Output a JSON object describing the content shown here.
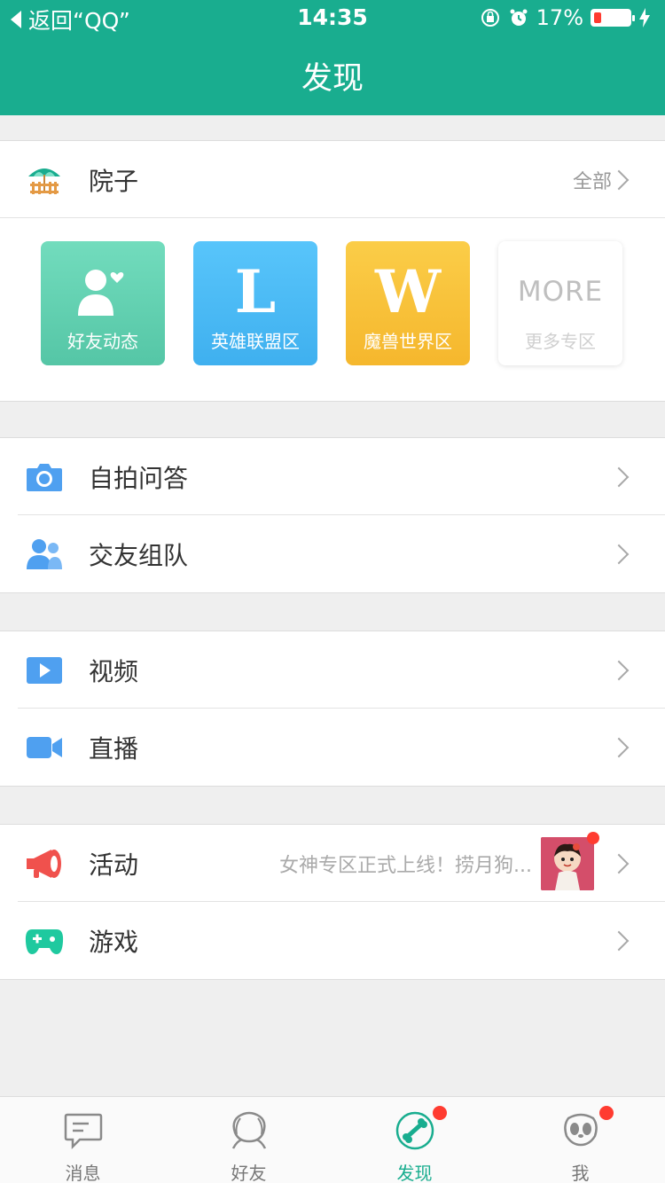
{
  "status_bar": {
    "back_label": "返回“QQ”",
    "time": "14:35",
    "battery": "17%"
  },
  "header": {
    "title": "发现"
  },
  "yard": {
    "label": "院子",
    "all_label": "全部",
    "tiles": [
      {
        "label": "好友动态",
        "color": "#5fcfb0"
      },
      {
        "label": "英雄联盟区",
        "glyph": "L",
        "color": "#4bb9f3"
      },
      {
        "label": "魔兽世界区",
        "glyph": "W",
        "color": "#f8c13a"
      },
      {
        "label": "更多专区",
        "glyph": "MORE",
        "color": "#ffffff"
      }
    ]
  },
  "group1": [
    {
      "label": "自拍问答",
      "icon": "camera-icon"
    },
    {
      "label": "交友组队",
      "icon": "people-icon"
    }
  ],
  "group2": [
    {
      "label": "视频",
      "icon": "video-play-icon"
    },
    {
      "label": "直播",
      "icon": "live-camera-icon"
    }
  ],
  "group3": [
    {
      "label": "活动",
      "icon": "megaphone-icon",
      "preview": "女神专区正式上线！捞月狗..."
    },
    {
      "label": "游戏",
      "icon": "gamepad-icon"
    }
  ],
  "tabbar": {
    "items": [
      {
        "label": "消息",
        "icon": "message-icon"
      },
      {
        "label": "好友",
        "icon": "friends-icon"
      },
      {
        "label": "发现",
        "icon": "discover-icon",
        "active": true
      },
      {
        "label": "我",
        "icon": "me-icon"
      }
    ]
  },
  "colors": {
    "brand": "#19ad8f",
    "badge": "#ff3b30"
  }
}
